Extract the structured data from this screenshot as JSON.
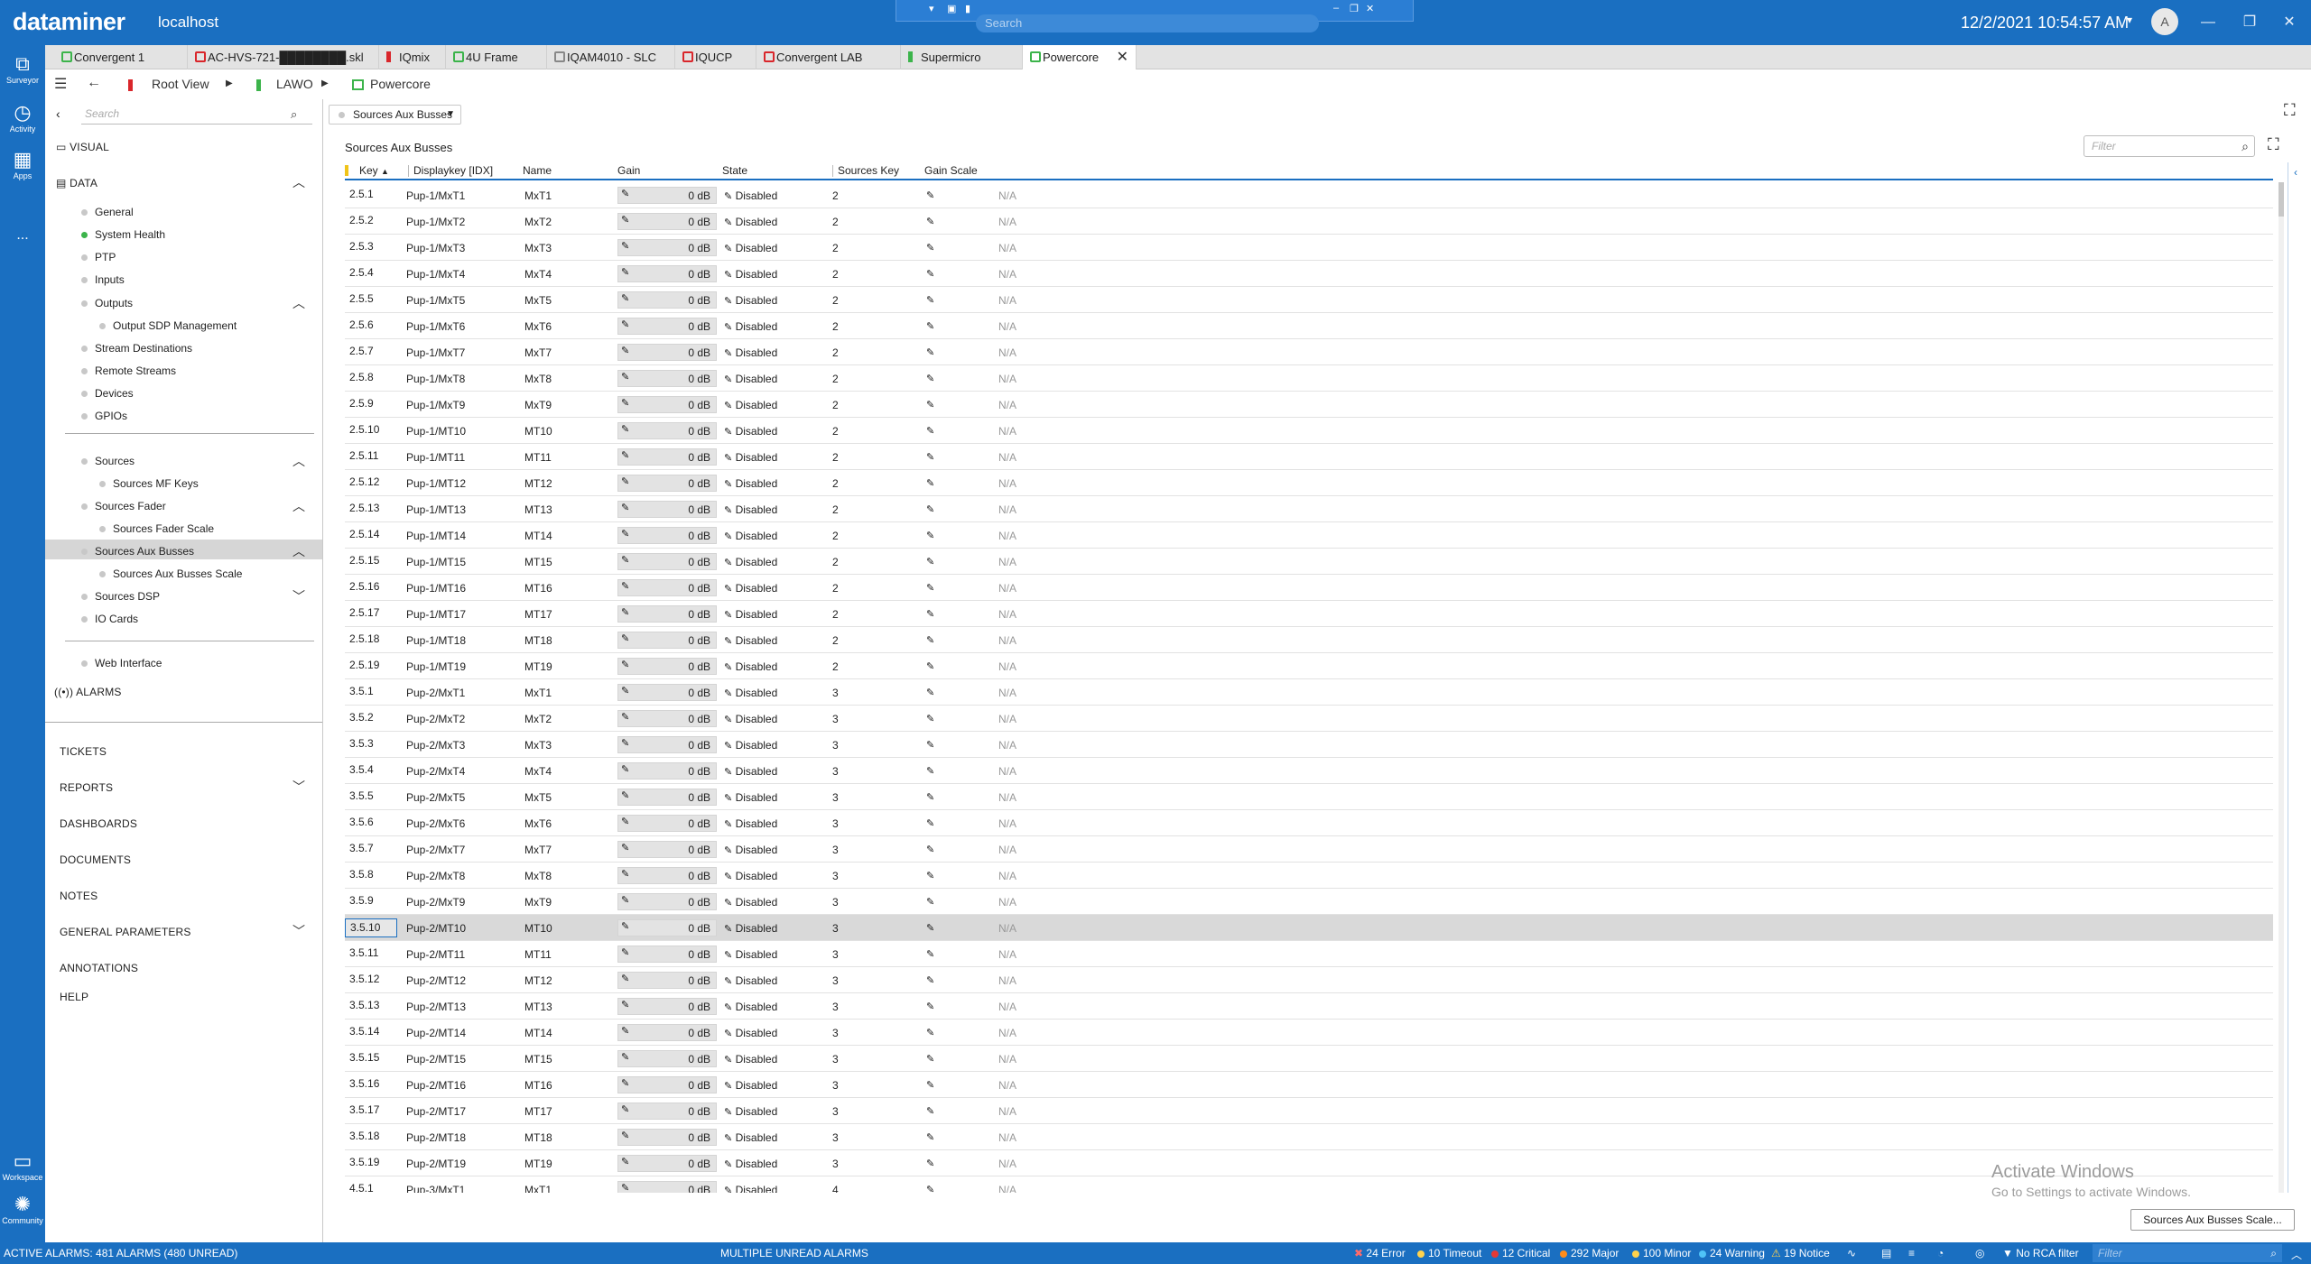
{
  "app": {
    "brand": "dataminer",
    "host": "localhost",
    "clock": "12/2/2021 10:54:57 AM",
    "avatar": "A"
  },
  "remote": {
    "search_placeholder": "Search"
  },
  "rail": [
    {
      "label": "Surveyor",
      "icon": "surveyor-icon"
    },
    {
      "label": "Activity",
      "icon": "activity-icon"
    },
    {
      "label": "Apps",
      "icon": "apps-icon"
    },
    {
      "label": "...",
      "icon": "more-icon"
    },
    {
      "label": "Workspace",
      "icon": "workspace-icon"
    },
    {
      "label": "Community",
      "icon": "community-icon"
    }
  ],
  "tabs": [
    {
      "label": "Convergent 1",
      "status": "green"
    },
    {
      "label": "AC-HVS-721-████████.skl",
      "status": "red"
    },
    {
      "label": "IQmix",
      "status": "red"
    },
    {
      "label": "4U Frame",
      "status": "green"
    },
    {
      "label": "IQAM4010 - SLC",
      "status": "gray"
    },
    {
      "label": "IQUCP",
      "status": "red"
    },
    {
      "label": "Convergent LAB",
      "status": "red"
    },
    {
      "label": "Supermicro",
      "status": "green"
    },
    {
      "label": "Powercore",
      "status": "green"
    }
  ],
  "breadcrumb": {
    "root": "Root View",
    "view": "LAWO",
    "element": "Powercore"
  },
  "sidebar": {
    "search_placeholder": "Search",
    "visual": "VISUAL",
    "data": "DATA",
    "items": [
      {
        "label": "General",
        "dot": "gray"
      },
      {
        "label": "System Health",
        "dot": "green"
      },
      {
        "label": "PTP",
        "dot": "gray"
      },
      {
        "label": "Inputs",
        "dot": "gray"
      },
      {
        "label": "Outputs",
        "dot": "gray"
      },
      {
        "label": "Output SDP Management",
        "dot": "gray"
      },
      {
        "label": "Stream Destinations",
        "dot": "gray"
      },
      {
        "label": "Remote Streams",
        "dot": "gray"
      },
      {
        "label": "Devices",
        "dot": "gray"
      },
      {
        "label": "GPIOs",
        "dot": "gray"
      },
      {
        "label": "Sources",
        "dot": "gray"
      },
      {
        "label": "Sources MF Keys",
        "dot": "gray"
      },
      {
        "label": "Sources Fader",
        "dot": "gray"
      },
      {
        "label": "Sources Fader Scale",
        "dot": "gray"
      },
      {
        "label": "Sources Aux Busses",
        "dot": "gray"
      },
      {
        "label": "Sources Aux Busses Scale",
        "dot": "gray"
      },
      {
        "label": "Sources DSP",
        "dot": "gray"
      },
      {
        "label": "IO Cards",
        "dot": "gray"
      },
      {
        "label": "Web Interface",
        "dot": "gray"
      }
    ],
    "alarms": "ALARMS",
    "modules": [
      "TICKETS",
      "REPORTS",
      "DASHBOARDS",
      "DOCUMENTS",
      "NOTES",
      "GENERAL PARAMETERS",
      "ANNOTATIONS",
      "HELP"
    ]
  },
  "content": {
    "dropdown": "Sources Aux Busses",
    "table_title": "Sources Aux Busses",
    "filter_placeholder": "Filter",
    "columns": [
      "Key",
      "Displaykey [IDX]",
      "Name",
      "Gain",
      "State",
      "Sources Key",
      "Gain Scale"
    ],
    "gain_value": "0 dB",
    "state_value": "Disabled",
    "gain_scale_value": "N/A",
    "rows": [
      {
        "key": "2.5.1",
        "display": "Pup-1/MxT1",
        "name": "MxT1",
        "src": "2"
      },
      {
        "key": "2.5.2",
        "display": "Pup-1/MxT2",
        "name": "MxT2",
        "src": "2"
      },
      {
        "key": "2.5.3",
        "display": "Pup-1/MxT3",
        "name": "MxT3",
        "src": "2"
      },
      {
        "key": "2.5.4",
        "display": "Pup-1/MxT4",
        "name": "MxT4",
        "src": "2"
      },
      {
        "key": "2.5.5",
        "display": "Pup-1/MxT5",
        "name": "MxT5",
        "src": "2"
      },
      {
        "key": "2.5.6",
        "display": "Pup-1/MxT6",
        "name": "MxT6",
        "src": "2"
      },
      {
        "key": "2.5.7",
        "display": "Pup-1/MxT7",
        "name": "MxT7",
        "src": "2"
      },
      {
        "key": "2.5.8",
        "display": "Pup-1/MxT8",
        "name": "MxT8",
        "src": "2"
      },
      {
        "key": "2.5.9",
        "display": "Pup-1/MxT9",
        "name": "MxT9",
        "src": "2"
      },
      {
        "key": "2.5.10",
        "display": "Pup-1/MT10",
        "name": "MT10",
        "src": "2"
      },
      {
        "key": "2.5.11",
        "display": "Pup-1/MT11",
        "name": "MT11",
        "src": "2"
      },
      {
        "key": "2.5.12",
        "display": "Pup-1/MT12",
        "name": "MT12",
        "src": "2"
      },
      {
        "key": "2.5.13",
        "display": "Pup-1/MT13",
        "name": "MT13",
        "src": "2"
      },
      {
        "key": "2.5.14",
        "display": "Pup-1/MT14",
        "name": "MT14",
        "src": "2"
      },
      {
        "key": "2.5.15",
        "display": "Pup-1/MT15",
        "name": "MT15",
        "src": "2"
      },
      {
        "key": "2.5.16",
        "display": "Pup-1/MT16",
        "name": "MT16",
        "src": "2"
      },
      {
        "key": "2.5.17",
        "display": "Pup-1/MT17",
        "name": "MT17",
        "src": "2"
      },
      {
        "key": "2.5.18",
        "display": "Pup-1/MT18",
        "name": "MT18",
        "src": "2"
      },
      {
        "key": "2.5.19",
        "display": "Pup-1/MT19",
        "name": "MT19",
        "src": "2"
      },
      {
        "key": "3.5.1",
        "display": "Pup-2/MxT1",
        "name": "MxT1",
        "src": "3"
      },
      {
        "key": "3.5.2",
        "display": "Pup-2/MxT2",
        "name": "MxT2",
        "src": "3"
      },
      {
        "key": "3.5.3",
        "display": "Pup-2/MxT3",
        "name": "MxT3",
        "src": "3"
      },
      {
        "key": "3.5.4",
        "display": "Pup-2/MxT4",
        "name": "MxT4",
        "src": "3"
      },
      {
        "key": "3.5.5",
        "display": "Pup-2/MxT5",
        "name": "MxT5",
        "src": "3"
      },
      {
        "key": "3.5.6",
        "display": "Pup-2/MxT6",
        "name": "MxT6",
        "src": "3"
      },
      {
        "key": "3.5.7",
        "display": "Pup-2/MxT7",
        "name": "MxT7",
        "src": "3"
      },
      {
        "key": "3.5.8",
        "display": "Pup-2/MxT8",
        "name": "MxT8",
        "src": "3"
      },
      {
        "key": "3.5.9",
        "display": "Pup-2/MxT9",
        "name": "MxT9",
        "src": "3"
      },
      {
        "key": "3.5.10",
        "display": "Pup-2/MT10",
        "name": "MT10",
        "src": "3",
        "selected": true
      },
      {
        "key": "3.5.11",
        "display": "Pup-2/MT11",
        "name": "MT11",
        "src": "3"
      },
      {
        "key": "3.5.12",
        "display": "Pup-2/MT12",
        "name": "MT12",
        "src": "3"
      },
      {
        "key": "3.5.13",
        "display": "Pup-2/MT13",
        "name": "MT13",
        "src": "3"
      },
      {
        "key": "3.5.14",
        "display": "Pup-2/MT14",
        "name": "MT14",
        "src": "3"
      },
      {
        "key": "3.5.15",
        "display": "Pup-2/MT15",
        "name": "MT15",
        "src": "3"
      },
      {
        "key": "3.5.16",
        "display": "Pup-2/MT16",
        "name": "MT16",
        "src": "3"
      },
      {
        "key": "3.5.17",
        "display": "Pup-2/MT17",
        "name": "MT17",
        "src": "3"
      },
      {
        "key": "3.5.18",
        "display": "Pup-2/MT18",
        "name": "MT18",
        "src": "3"
      },
      {
        "key": "3.5.19",
        "display": "Pup-2/MT19",
        "name": "MT19",
        "src": "3"
      },
      {
        "key": "4.5.1",
        "display": "Pup-3/MxT1",
        "name": "MxT1",
        "src": "4"
      }
    ],
    "scale_button": "Sources Aux Busses Scale...",
    "watermark_title": "Activate Windows",
    "watermark_sub": "Go to Settings to activate Windows."
  },
  "statusbar": {
    "active_alarms": "ACTIVE ALARMS: 481 ALARMS (480 UNREAD)",
    "multiple_unread": "MULTIPLE UNREAD ALARMS",
    "error": "24 Error",
    "timeout": "10 Timeout",
    "critical": "12 Critical",
    "major": "292 Major",
    "minor": "100 Minor",
    "warning": "24 Warning",
    "notice": "19 Notice",
    "rca": "No RCA filter",
    "filter_placeholder": "Filter"
  },
  "colors": {
    "accent": "#1a6fc1",
    "green": "#3cb44b",
    "red": "#d9262b"
  }
}
